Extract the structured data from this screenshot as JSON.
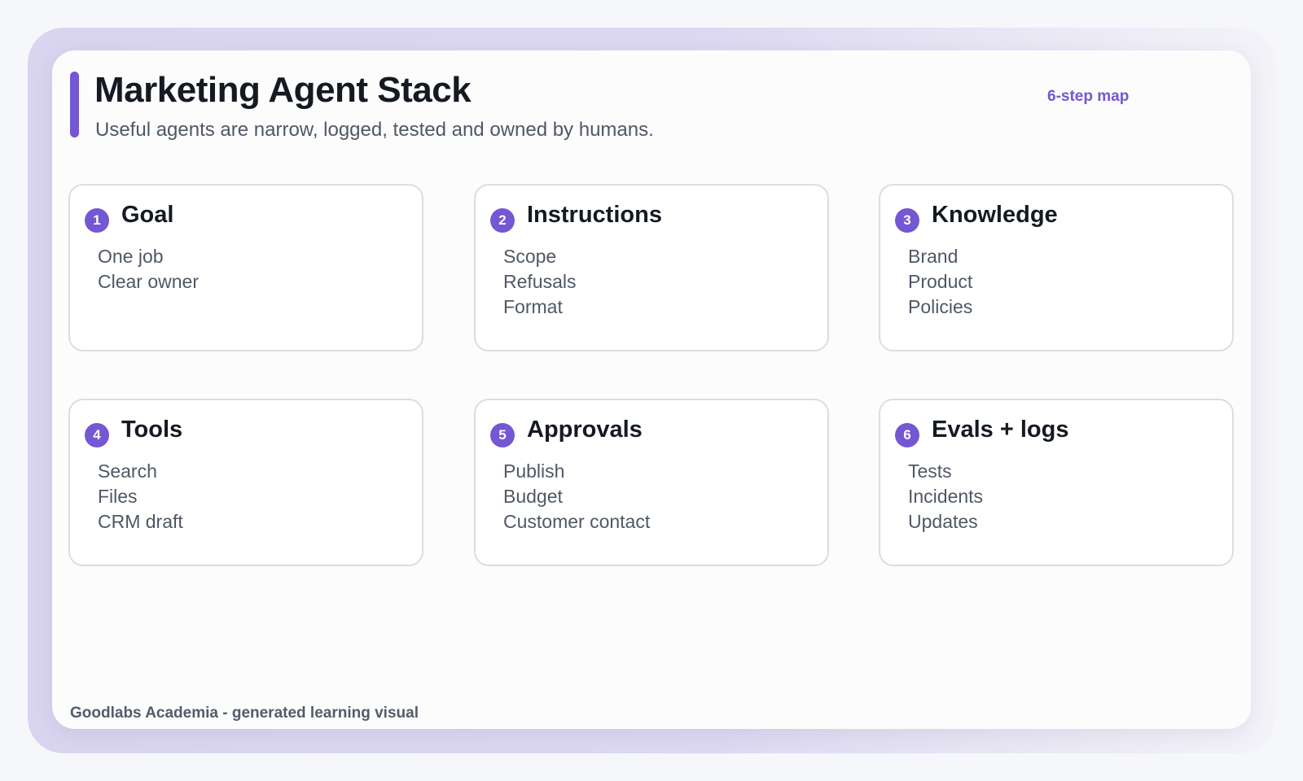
{
  "header": {
    "title": "Marketing Agent Stack",
    "subtitle": "Useful agents are narrow, logged, tested and owned by humans.",
    "step_map_label": "6-step map"
  },
  "steps": [
    {
      "number": "1",
      "title": "Goal",
      "items": [
        "One job",
        "Clear owner"
      ]
    },
    {
      "number": "2",
      "title": "Instructions",
      "items": [
        "Scope",
        "Refusals",
        "Format"
      ]
    },
    {
      "number": "3",
      "title": "Knowledge",
      "items": [
        "Brand",
        "Product",
        "Policies"
      ]
    },
    {
      "number": "4",
      "title": "Tools",
      "items": [
        "Search",
        "Files",
        "CRM draft"
      ]
    },
    {
      "number": "5",
      "title": "Approvals",
      "items": [
        "Publish",
        "Budget",
        "Customer contact"
      ]
    },
    {
      "number": "6",
      "title": "Evals + logs",
      "items": [
        "Tests",
        "Incidents",
        "Updates"
      ]
    }
  ],
  "footer": {
    "credit": "Goodlabs Academia - generated learning visual"
  },
  "colors": {
    "accent": "#7457d2",
    "text_dark": "#151a22",
    "text_muted": "#4f5866",
    "box_border": "#dcdde2"
  }
}
